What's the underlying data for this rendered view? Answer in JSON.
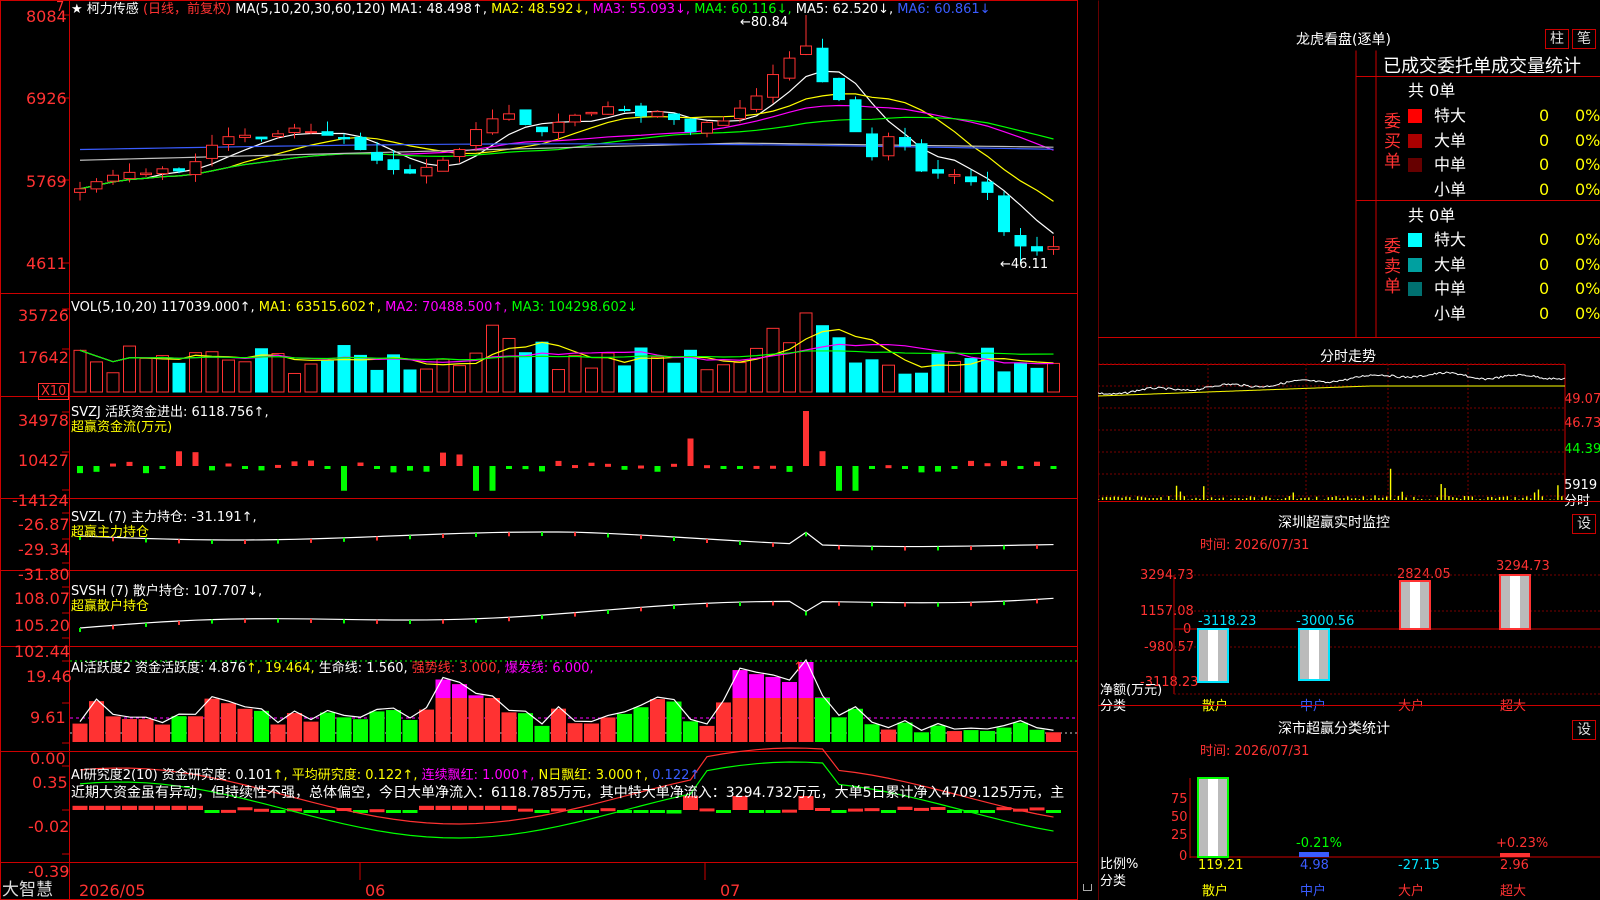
{
  "colors": {
    "up": "#ff3232",
    "down": "#00ffff",
    "bg": "#000000",
    "frame": "#cc0000",
    "ma1": "#ffffff",
    "ma2": "#ffff00",
    "ma3": "#ff00ff",
    "ma4": "#00ff00",
    "ma5": "#c0c0c0",
    "ma6": "#3a5cff"
  },
  "main": {
    "star": "★",
    "name": "柯力传感",
    "mode": "(日线，前复权)",
    "ma_label": "MA(5,10,20,30,60,120)",
    "ma1": "MA1: 48.498↑,",
    "ma2": "MA2: 48.592↓,",
    "ma3": "MA3: 55.093↓,",
    "ma4": "MA4: 60.116↓,",
    "ma5": "MA5: 62.520↓,",
    "ma6": "MA6: 60.861↓",
    "high_mark": "80.84",
    "low_mark": "46.11",
    "y_ticks": [
      "8084",
      "6926",
      "5769",
      "4611"
    ],
    "top_tag": "7"
  },
  "vol": {
    "label": "VOL(5,10,20)",
    "value": "117039.000↑,",
    "ma1": "MA1: 63515.602↑,",
    "ma2": "MA2: 70488.500↑,",
    "ma3": "MA3: 104298.602↓",
    "y_ticks": [
      "35726",
      "17642"
    ],
    "unit": "X10"
  },
  "svzj": {
    "label": "SVZJ  活跃资金进出: 6118.756↑,",
    "sub": "超赢资金流(万元)",
    "y_ticks": [
      "34978",
      "10427",
      "-14124"
    ]
  },
  "svzl": {
    "label": "SVZL (7) 主力持仓: -31.191↑,",
    "sub": "超赢主力持仓",
    "y_ticks": [
      "-26.87",
      "-29.34",
      "-31.80"
    ]
  },
  "svsh": {
    "label": "SVSH (7) 散户持仓: 107.707↓,",
    "sub": "超赢散户持仓",
    "y_ticks": [
      "108.07",
      "105.20",
      "102.44"
    ]
  },
  "ai1": {
    "label": "AI活跃度2 资金活跃度: 4.876",
    "v2": "↑, 19.464,",
    "life": "生命线: 1.560,",
    "strong": "强势线: 3.000,",
    "burst": "爆发线: 6.000,",
    "arrow": "↑",
    "y_ticks": [
      "19.46",
      "9.61",
      "0.00"
    ]
  },
  "ai2": {
    "label": "AI研究度2(10) 资金研究度: 0.101",
    "avg": "↑, 平均研究度: 0.122↑,",
    "lian": "连续飘红: 1.000↑,",
    "nday": "N日飘红: 3.000↑,",
    "last": "0.122↑",
    "desc": "近期大资金虽有异动，但持续性不强，总体偏空，今日大单净流入：6118.785万元，其中特大单净流入：3294.732万元，大单5日累计净入4709.125万元，主",
    "y_ticks": [
      "0.35",
      "-0.02",
      "-0.39"
    ]
  },
  "footer": {
    "brand": "大智慧",
    "dates": [
      "2026/05",
      "06",
      "07"
    ]
  },
  "right": {
    "lhb_title": "龙虎看盘(逐单)",
    "btn_zhu": "柱",
    "btn_bi": "笔",
    "tabs_title": "已成交委托单成交量统计",
    "buy_side": "委买单",
    "sell_side": "委卖单",
    "buy_total": "共 0单",
    "sell_total": "共 0单",
    "buy_rows": [
      {
        "label": "特大",
        "n": "0",
        "p": "0%",
        "c": "#ff0000"
      },
      {
        "label": "大单",
        "n": "0",
        "p": "0%",
        "c": "#aa0000"
      },
      {
        "label": "中单",
        "n": "0",
        "p": "0%",
        "c": "#660000"
      },
      {
        "label": "小单",
        "n": "0",
        "p": "0%",
        "c": ""
      }
    ],
    "sell_rows": [
      {
        "label": "特大",
        "n": "0",
        "p": "0%",
        "c": "#00ffff"
      },
      {
        "label": "大单",
        "n": "0",
        "p": "0%",
        "c": "#00a0a0"
      },
      {
        "label": "中单",
        "n": "0",
        "p": "0%",
        "c": "#007070"
      },
      {
        "label": "小单",
        "n": "0",
        "p": "0%",
        "c": ""
      }
    ],
    "fenshi_title": "分时走势",
    "fenshi_ticks": [
      "49.07",
      "46.73",
      "44.39"
    ],
    "fenshi_vol": "5919",
    "fenshi_unit": "分时",
    "sz_title": "深圳超赢实时监控",
    "sz_btn": "设",
    "sz_time": "时间: 2026/07/31",
    "sz_ticks": [
      "3294.73",
      "1157.08",
      "0",
      "-980.57",
      "-3118.23"
    ],
    "sz_vals": [
      "-3118.23",
      "-3000.56",
      "2824.05",
      "3294.73"
    ],
    "sz_ylabel": "净额(万元)",
    "sz_xlabel": "分类",
    "cats": [
      "散户",
      "中户",
      "大户",
      "超大"
    ],
    "fl_title": "深市超赢分类统计",
    "fl_btn": "设",
    "fl_time": "时间: 2026/07/31",
    "fl_ticks": [
      "75",
      "50",
      "25",
      "0"
    ],
    "fl_pcts": [
      "-0.21%",
      "+0.23%"
    ],
    "fl_vals": [
      "119.21",
      "4.98",
      "-27.15",
      "2.96"
    ],
    "fl_ylabel": "比例%",
    "fl_xlabel": "分类"
  },
  "chart_data": {
    "type": "candlestick",
    "title": "柯力传感 (日线，前复权)",
    "ylim": [
      46.11,
      80.84
    ],
    "x_labels": [
      "2026/05",
      "06",
      "07"
    ],
    "annotations": {
      "high": 80.84,
      "low": 46.11
    },
    "moving_averages": {
      "MA1": 48.498,
      "MA2": 48.592,
      "MA3": 55.093,
      "MA4": 60.116,
      "MA5": 62.52,
      "MA6": 60.861
    },
    "volume": {
      "last": 117039,
      "MA1": 63515.602,
      "MA2": 70488.5,
      "MA3": 104298.602
    }
  }
}
